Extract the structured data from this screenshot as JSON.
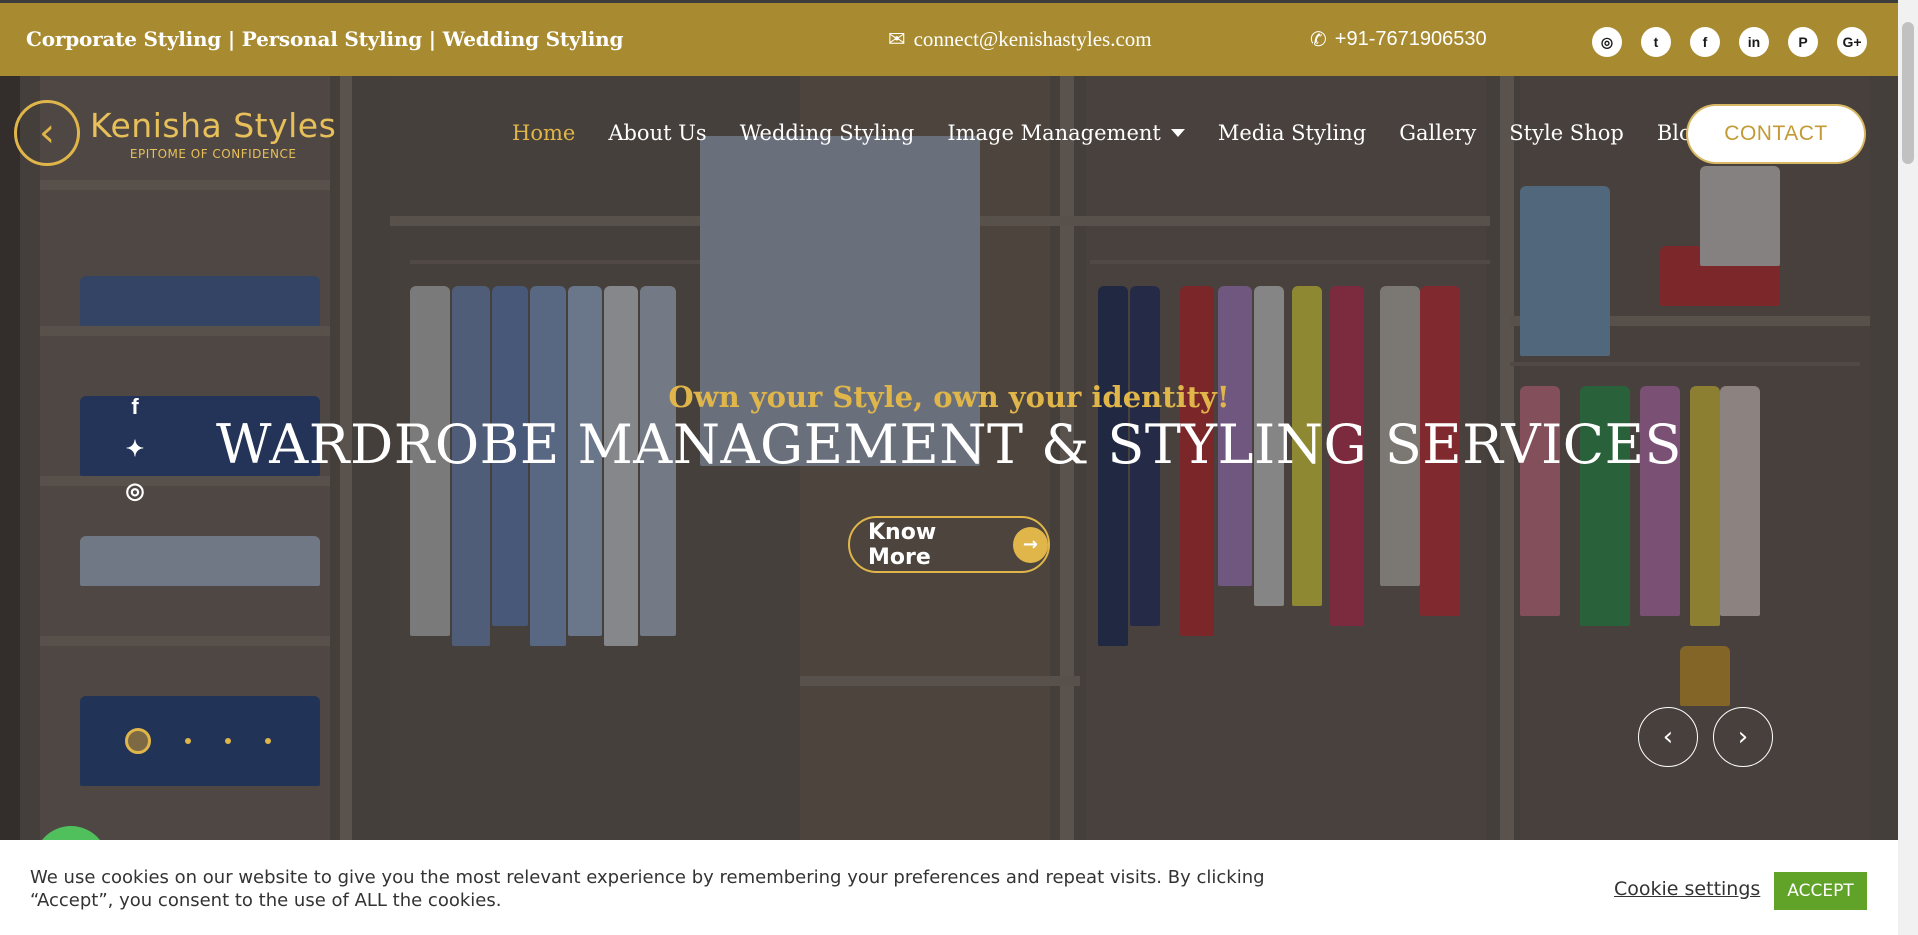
{
  "topbar": {
    "services": "Corporate Styling | Personal Styling | Wedding Styling",
    "email": "connect@kenishastyles.com",
    "phone": "+91-7671906530",
    "socials": [
      {
        "name": "instagram-icon",
        "glyph": "◎"
      },
      {
        "name": "twitter-icon",
        "glyph": "t"
      },
      {
        "name": "facebook-icon",
        "glyph": "f"
      },
      {
        "name": "linkedin-icon",
        "glyph": "in"
      },
      {
        "name": "pinterest-icon",
        "glyph": "P"
      },
      {
        "name": "google-plus-icon",
        "glyph": "G+"
      }
    ]
  },
  "logo": {
    "name": "Kenisha Styles",
    "tagline": "EPITOME OF CONFIDENCE"
  },
  "nav": {
    "items": [
      "Home",
      "About Us",
      "Wedding Styling",
      "Image Management",
      "Media Styling",
      "Gallery",
      "Style Shop",
      "Blog"
    ],
    "active": "Home",
    "contact": "CONTACT"
  },
  "hero": {
    "tagline": "Own your Style, own your identity!",
    "headline": "WARDROBE MANAGEMENT & STYLING SERVICES",
    "cta": "Know More",
    "slide_count": 4,
    "active_slide": 1
  },
  "cookie": {
    "message": "We use cookies on our website to give you the most relevant experience by remembering your preferences and repeat visits. By clicking “Accept”, you consent to the use of ALL the cookies.",
    "settings": "Cookie settings",
    "accept": "ACCEPT"
  },
  "colors": {
    "brand_gold": "#a88b30",
    "accent_gold": "#e0b64a",
    "accept_green": "#61a229"
  }
}
